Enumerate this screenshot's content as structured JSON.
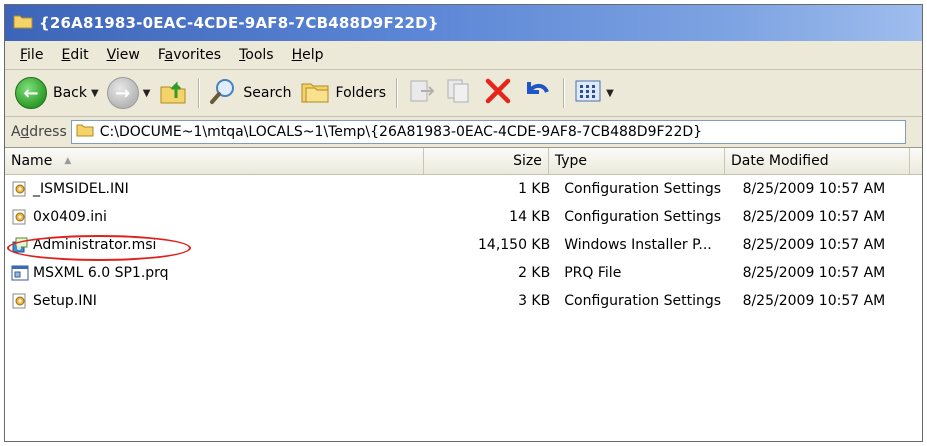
{
  "window": {
    "title": "{26A81983-0EAC-4CDE-9AF8-7CB488D9F22D}"
  },
  "menu": [
    {
      "label_pre": "",
      "label_u": "F",
      "label_post": "ile"
    },
    {
      "label_pre": "",
      "label_u": "E",
      "label_post": "dit"
    },
    {
      "label_pre": "",
      "label_u": "V",
      "label_post": "iew"
    },
    {
      "label_pre": "F",
      "label_u": "a",
      "label_post": "vorites"
    },
    {
      "label_pre": "",
      "label_u": "T",
      "label_post": "ools"
    },
    {
      "label_pre": "",
      "label_u": "H",
      "label_post": "elp"
    }
  ],
  "toolbar": {
    "back_label": "Back",
    "search_label": "Search",
    "folders_label": "Folders"
  },
  "address": {
    "label_pre": "A",
    "label_u": "d",
    "label_post": "dress",
    "path": "C:\\DOCUME~1\\mtqa\\LOCALS~1\\Temp\\{26A81983-0EAC-4CDE-9AF8-7CB488D9F22D}"
  },
  "columns": {
    "name": "Name",
    "size": "Size",
    "type": "Type",
    "date": "Date Modified"
  },
  "files": [
    {
      "name": "_ISMSIDEL.INI",
      "size": "1 KB",
      "type": "Configuration Settings",
      "date": "8/25/2009 10:57 AM",
      "icon": "config-file-icon"
    },
    {
      "name": "0x0409.ini",
      "size": "14 KB",
      "type": "Configuration Settings",
      "date": "8/25/2009 10:57 AM",
      "icon": "config-file-icon"
    },
    {
      "name": "Administrator.msi",
      "size": "14,150 KB",
      "type": "Windows Installer P...",
      "date": "8/25/2009 10:57 AM",
      "icon": "installer-package-icon",
      "highlighted": true
    },
    {
      "name": "MSXML 6.0 SP1.prq",
      "size": "2 KB",
      "type": "PRQ File",
      "date": "8/25/2009 10:57 AM",
      "icon": "generic-file-icon"
    },
    {
      "name": "Setup.INI",
      "size": "3 KB",
      "type": "Configuration Settings",
      "date": "8/25/2009 10:57 AM",
      "icon": "config-file-icon"
    }
  ],
  "colors": {
    "title_bar": "#3c64b8",
    "highlight_ellipse": "#e0201a",
    "delete_x": "#e8231a"
  }
}
